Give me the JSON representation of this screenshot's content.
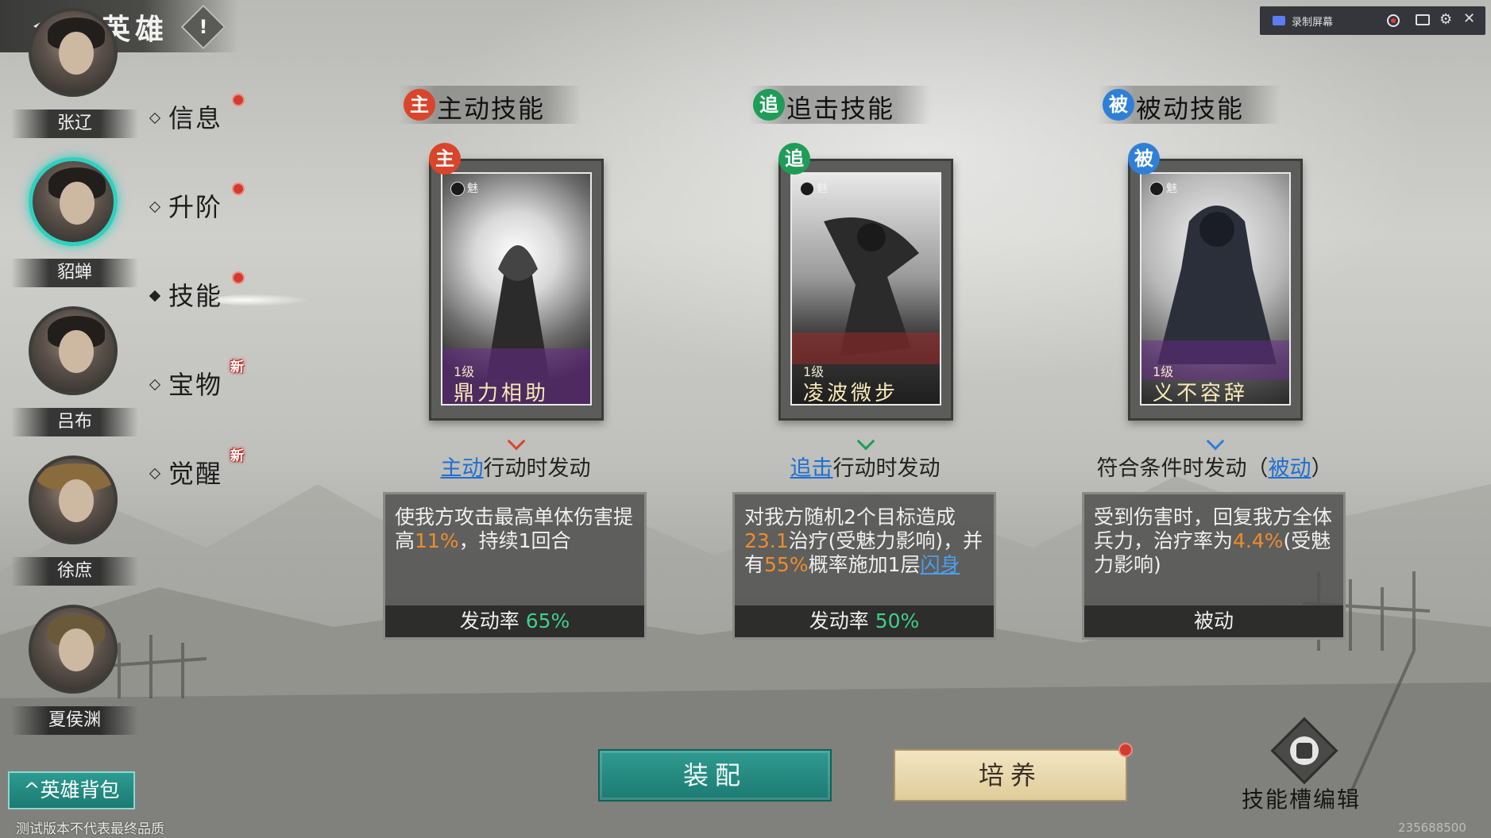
{
  "header": {
    "title": "英雄",
    "info_symbol": "!"
  },
  "recorder": {
    "label": "录制屏幕"
  },
  "heroes": [
    {
      "name": "张辽",
      "selected": false
    },
    {
      "name": "貂蝉",
      "selected": true
    },
    {
      "name": "吕布",
      "selected": false
    },
    {
      "name": "徐庶",
      "selected": false
    },
    {
      "name": "夏侯渊",
      "selected": false
    }
  ],
  "tabs": [
    {
      "label": "信息",
      "badge": "dot"
    },
    {
      "label": "升阶",
      "badge": "dot"
    },
    {
      "label": "技能",
      "badge": "dot",
      "active": true
    },
    {
      "label": "宝物",
      "badge": "新"
    },
    {
      "label": "觉醒",
      "badge": "新"
    }
  ],
  "skills": [
    {
      "type_char": "主",
      "header": "主动技能",
      "color": "#d9452b",
      "attr": "魅",
      "level": "1级",
      "name": "鼎力相助",
      "trigger_hl": "主动",
      "trigger_rest": "行动时发动",
      "trigger_pre": "",
      "trigger_post": "",
      "desc": [
        "使我方攻击最高单体伤害提高",
        "11%",
        "，持续1回合"
      ],
      "footer_label": "发动率 ",
      "footer_value": "65%"
    },
    {
      "type_char": "追",
      "header": "追击技能",
      "color": "#1f9c57",
      "attr": "魅",
      "level": "1级",
      "name": "凌波微步",
      "trigger_hl": "追击",
      "trigger_rest": "行动时发动",
      "trigger_pre": "",
      "trigger_post": "",
      "desc": [
        "对我方随机2个目标造成",
        "23.1",
        "治疗(受魅力影响)，并有",
        "55%",
        "概率施加1层",
        "闪身"
      ],
      "footer_label": "发动率 ",
      "footer_value": "50%"
    },
    {
      "type_char": "被",
      "header": "被动技能",
      "color": "#2f7fd6",
      "attr": "魅",
      "level": "1级",
      "name": "义不容辞",
      "trigger_hl": "被动",
      "trigger_rest": "",
      "trigger_pre": "符合条件时发动（",
      "trigger_post": "）",
      "desc": [
        "受到伤害时，回复我方全体兵力，治疗率为",
        "4.4%",
        "(受魅力影响)"
      ],
      "footer_label": "被动",
      "footer_value": ""
    }
  ],
  "buttons": {
    "equip": "装配",
    "train": "培养",
    "slot_edit": "技能槽编辑",
    "hero_bag": "英雄背包"
  },
  "footer": {
    "disclaimer": "测试版本不代表最终品质",
    "uid": "235688500"
  }
}
